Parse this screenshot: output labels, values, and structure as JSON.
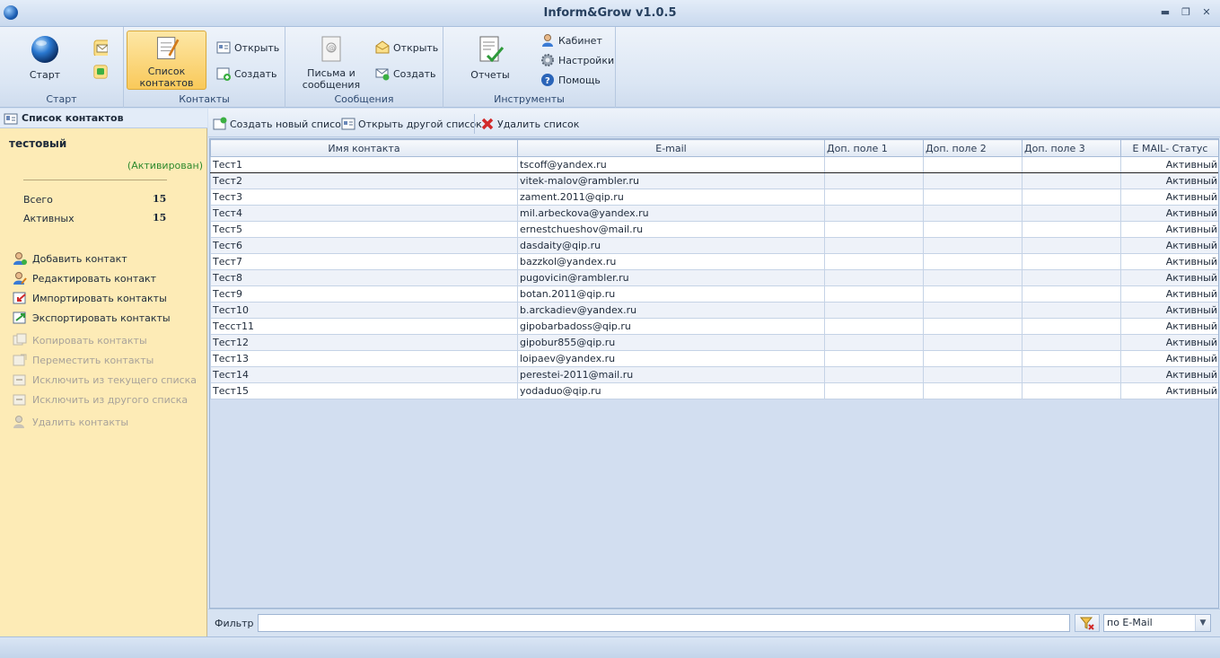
{
  "window": {
    "title": "Inform&Grow v1.0.5",
    "controls": {
      "minimize": "▬",
      "restore": "❐",
      "close": "✕"
    }
  },
  "ribbon": {
    "groups": {
      "start": {
        "label": "Старт",
        "start_button": "Старт"
      },
      "contacts": {
        "label": "Контакты",
        "list_button_line1": "Список",
        "list_button_line2": "контактов",
        "open": "Открыть",
        "create": "Создать"
      },
      "messages": {
        "label": "Сообщения",
        "letters_line1": "Письма и",
        "letters_line2": "сообщения",
        "open": "Открыть",
        "create": "Создать"
      },
      "tools": {
        "label": "Инструменты",
        "reports": "Отчеты",
        "cabinet": "Кабинет",
        "settings": "Настройки",
        "help": "Помощь"
      }
    }
  },
  "sidebar": {
    "header": "Список контактов",
    "list_name": "тестовый",
    "list_status": "(Активирован)",
    "stats": [
      {
        "label": "Всего",
        "value": "15"
      },
      {
        "label": "Активных",
        "value": "15"
      }
    ],
    "actions": [
      {
        "label": "Добавить контакт",
        "enabled": true,
        "icon": "add-contact-icon"
      },
      {
        "label": "Редактировать контакт",
        "enabled": true,
        "icon": "edit-contact-icon"
      },
      {
        "label": "Импортировать контакты",
        "enabled": true,
        "icon": "import-icon"
      },
      {
        "label": "Экспортировать контакты",
        "enabled": true,
        "icon": "export-icon"
      },
      {
        "label": "Копировать контакты",
        "enabled": false,
        "icon": "copy-icon"
      },
      {
        "label": "Переместить контакты",
        "enabled": false,
        "icon": "move-icon"
      },
      {
        "label": "Исключить из текущего списка",
        "enabled": false,
        "icon": "exclude-icon"
      },
      {
        "label": "Исключить из другого списка",
        "enabled": false,
        "icon": "exclude-other-icon"
      },
      {
        "label": "Удалить контакты",
        "enabled": false,
        "icon": "delete-contact-icon"
      }
    ]
  },
  "toolbar": {
    "create_list": "Создать новый список",
    "open_list": "Открыть другой список",
    "delete_list": "Удалить  список"
  },
  "table": {
    "columns": [
      "Имя контакта",
      "E-mail",
      "Доп. поле 1",
      "Доп. поле 2",
      "Доп. поле 3",
      "E MAIL- Статус"
    ],
    "rows": [
      {
        "name": "Тест1",
        "email": "tscoff@yandex.ru",
        "f1": "",
        "f2": "",
        "f3": "",
        "status": "Активный"
      },
      {
        "name": "Тест2",
        "email": "vitek-malov@rambler.ru",
        "f1": "",
        "f2": "",
        "f3": "",
        "status": "Активный"
      },
      {
        "name": "Тест3",
        "email": "zament.2011@qip.ru",
        "f1": "",
        "f2": "",
        "f3": "",
        "status": "Активный"
      },
      {
        "name": "Тест4",
        "email": "mil.arbeckova@yandex.ru",
        "f1": "",
        "f2": "",
        "f3": "",
        "status": "Активный"
      },
      {
        "name": "Тест5",
        "email": "ernestchueshov@mail.ru",
        "f1": "",
        "f2": "",
        "f3": "",
        "status": "Активный"
      },
      {
        "name": "Тест6",
        "email": "dasdaity@qip.ru",
        "f1": "",
        "f2": "",
        "f3": "",
        "status": "Активный"
      },
      {
        "name": "Тест7",
        "email": "bazzkol@yandex.ru",
        "f1": "",
        "f2": "",
        "f3": "",
        "status": "Активный"
      },
      {
        "name": "Тест8",
        "email": "pugovicin@rambler.ru",
        "f1": "",
        "f2": "",
        "f3": "",
        "status": "Активный"
      },
      {
        "name": "Тест9",
        "email": "botan.2011@qip.ru",
        "f1": "",
        "f2": "",
        "f3": "",
        "status": "Активный"
      },
      {
        "name": "Тест10",
        "email": "b.arckadiev@yandex.ru",
        "f1": "",
        "f2": "",
        "f3": "",
        "status": "Активный"
      },
      {
        "name": "Тесст11",
        "email": "gipobarbadoss@qip.ru",
        "f1": "",
        "f2": "",
        "f3": "",
        "status": "Активный"
      },
      {
        "name": "Тест12",
        "email": "gipobur855@qip.ru",
        "f1": "",
        "f2": "",
        "f3": "",
        "status": "Активный"
      },
      {
        "name": "Тест13",
        "email": "loipaev@yandex.ru",
        "f1": "",
        "f2": "",
        "f3": "",
        "status": "Активный"
      },
      {
        "name": "Тест14",
        "email": "perestei-2011@mail.ru",
        "f1": "",
        "f2": "",
        "f3": "",
        "status": "Активный"
      },
      {
        "name": "Тест15",
        "email": "yodaduo@qip.ru",
        "f1": "",
        "f2": "",
        "f3": "",
        "status": "Активный"
      }
    ]
  },
  "filter": {
    "label": "Фильтр",
    "value": "",
    "mode": "по E-Mail"
  }
}
